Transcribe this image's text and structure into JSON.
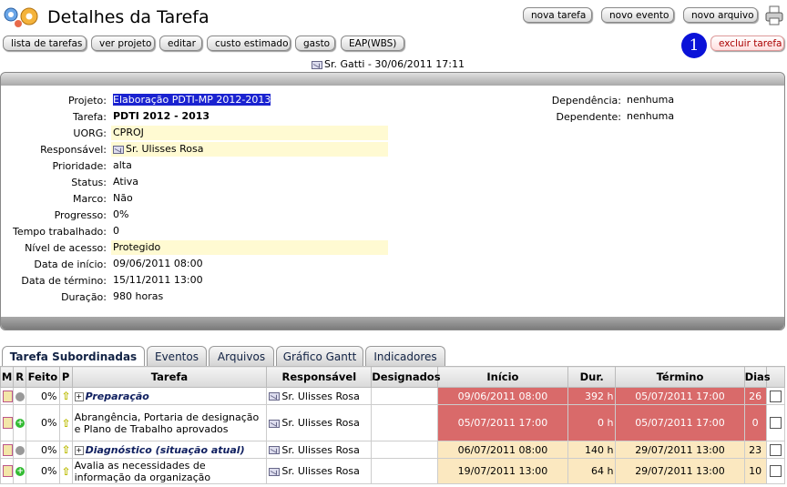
{
  "header": {
    "title": "Detalhes da Tarefa"
  },
  "toolbar_top": {
    "nova_tarefa": "nova tarefa",
    "novo_evento": "novo evento",
    "novo_arquivo": "novo arquivo"
  },
  "toolbar": {
    "lista": "lista de tarefas",
    "ver_projeto": "ver projeto",
    "editar": "editar",
    "custo": "custo estimado",
    "gasto": "gasto",
    "eap": "EAP(WBS)",
    "excluir": "excluir tarefa",
    "badge": "1"
  },
  "author_line": "Sr. Gatti - 30/06/2011 17:11",
  "details": {
    "projeto_label": "Projeto:",
    "projeto": "Elaboração PDTI-MP 2012-2013",
    "tarefa_label": "Tarefa:",
    "tarefa": "PDTI 2012 - 2013",
    "uorg_label": "UORG:",
    "uorg": "CPROJ",
    "responsavel_label": "Responsável:",
    "responsavel": "Sr. Ulisses Rosa",
    "prioridade_label": "Prioridade:",
    "prioridade": "alta",
    "status_label": "Status:",
    "status": "Ativa",
    "marco_label": "Marco:",
    "marco": "Não",
    "progresso_label": "Progresso:",
    "progresso": "0%",
    "tempo_label": "Tempo trabalhado:",
    "tempo": "0",
    "nivel_label": "Nível de acesso:",
    "nivel": "Protegido",
    "inicio_label": "Data de início:",
    "inicio": "09/06/2011 08:00",
    "termino_label": "Data de término:",
    "termino": "15/11/2011 13:00",
    "duracao_label": "Duração:",
    "duracao": "980 horas",
    "dependencia_label": "Dependência:",
    "dependencia": "nenhuma",
    "dependente_label": "Dependente:",
    "dependente": "nenhuma"
  },
  "tabs": [
    "Tarefa Subordinadas",
    "Eventos",
    "Arquivos",
    "Gráfico Gantt",
    "Indicadores"
  ],
  "grid": {
    "headers": {
      "m": "M",
      "r": "R",
      "feito": "Feito",
      "p": "P",
      "tarefa": "Tarefa",
      "responsavel": "Responsável",
      "designados": "Designados",
      "inicio": "Início",
      "dur": "Dur.",
      "termino": "Término",
      "dias": "Dias"
    },
    "rows": [
      {
        "feito": "0%",
        "tarefa": "Preparação",
        "responsavel": "Sr. Ulisses Rosa",
        "designados": "",
        "inicio": "09/06/2011 08:00",
        "dur": "392 h",
        "termino": "05/07/2011 17:00",
        "dias": "26"
      },
      {
        "feito": "0%",
        "tarefa": "Abrangência, Portaria de designação e Plano de Trabalho aprovados",
        "responsavel": "Sr. Ulisses Rosa",
        "designados": "",
        "inicio": "05/07/2011 17:00",
        "dur": "0 h",
        "termino": "05/07/2011 17:00",
        "dias": "0"
      },
      {
        "feito": "0%",
        "tarefa": "Diagnóstico (situação atual)",
        "responsavel": "Sr. Ulisses Rosa",
        "designados": "",
        "inicio": "06/07/2011 08:00",
        "dur": "140 h",
        "termino": "29/07/2011 13:00",
        "dias": "23"
      },
      {
        "feito": "0%",
        "tarefa": "Avalia as necessidades de informação da organização",
        "responsavel": "Sr. Ulisses Rosa",
        "designados": "",
        "inicio": "19/07/2011 13:00",
        "dur": "64 h",
        "termino": "29/07/2011 13:00",
        "dias": "10"
      }
    ]
  }
}
